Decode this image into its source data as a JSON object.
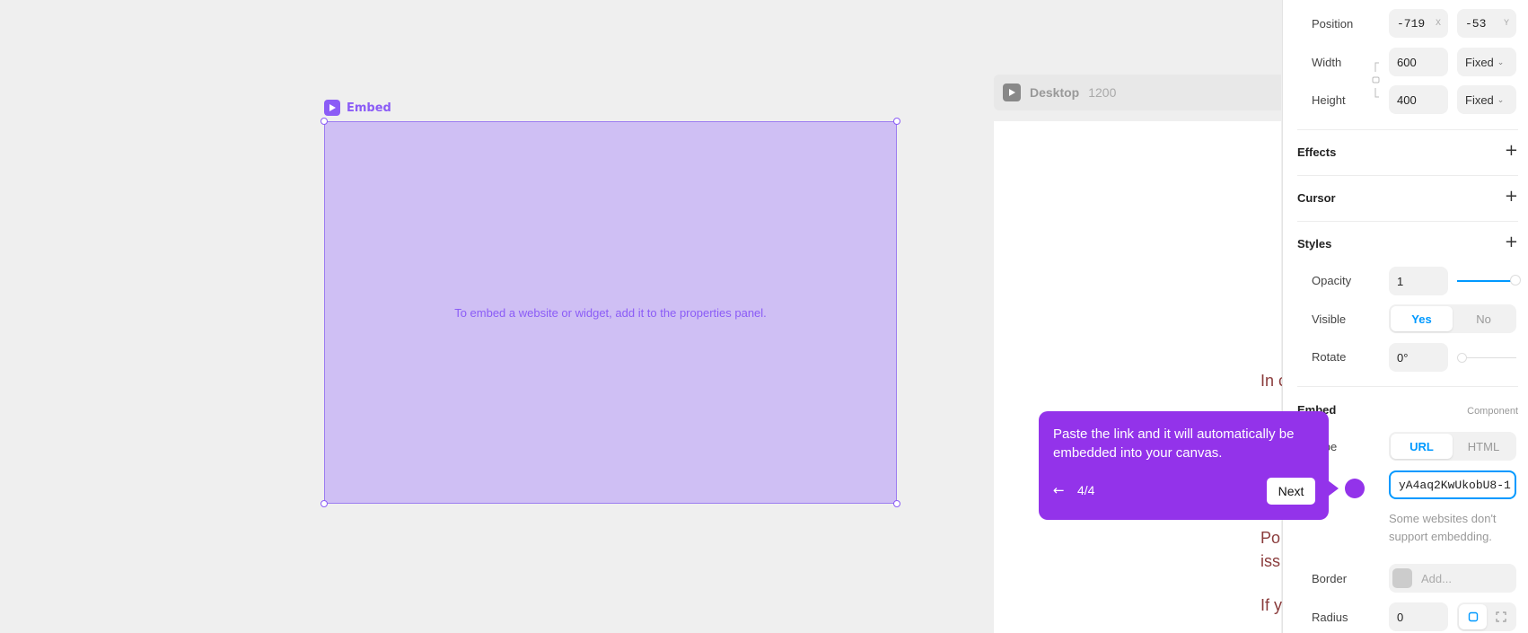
{
  "canvas": {
    "embed_label": "Embed",
    "embed_placeholder": "To embed a website or widget, add it to the properties panel.",
    "desktop_name": "Desktop",
    "desktop_width": "1200",
    "page_fragments": [
      "In c",
      "Po",
      "iss",
      "If y"
    ]
  },
  "panel": {
    "position": {
      "label": "Position",
      "x": "-719",
      "x_suffix": "X",
      "y": "-53",
      "y_suffix": "Y"
    },
    "width": {
      "label": "Width",
      "value": "600",
      "mode": "Fixed"
    },
    "height": {
      "label": "Height",
      "value": "400",
      "mode": "Fixed"
    },
    "effects": "Effects",
    "cursor": "Cursor",
    "styles": "Styles",
    "opacity": {
      "label": "Opacity",
      "value": "1",
      "level": 1
    },
    "visible": {
      "label": "Visible",
      "yes": "Yes",
      "no": "No",
      "selected": "Yes"
    },
    "rotate": {
      "label": "Rotate",
      "value": "0°"
    },
    "embed_section": {
      "title": "Embed",
      "badge": "Component"
    },
    "type": {
      "label": "Type",
      "url": "URL",
      "html": "HTML",
      "selected": "URL"
    },
    "url_value": "yA4aq2KwUkobU8-1",
    "hint": "Some websites don't support embedding.",
    "border": {
      "label": "Border",
      "placeholder": "Add..."
    },
    "radius": {
      "label": "Radius",
      "value": "0"
    }
  },
  "tooltip": {
    "message": "Paste the link and it will automatically be embedded into your canvas.",
    "step": "4/4",
    "next": "Next"
  },
  "colors": {
    "accent": "#9333ea",
    "embed_fill": "#cfbff4",
    "link_blue": "#0099ff"
  }
}
